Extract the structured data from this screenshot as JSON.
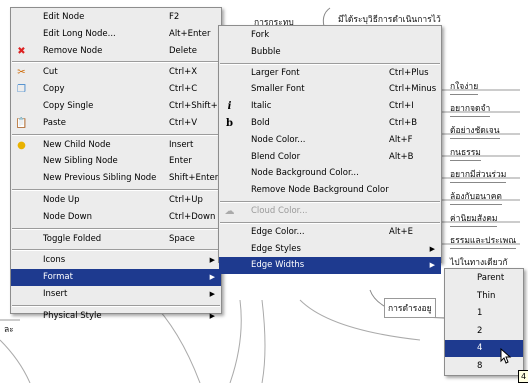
{
  "mindmap": {
    "nodes": [
      "มีได้ระบุวิธีการดำเนินการไว้",
      "การกระทบ",
      "กใจง่าย",
      "อยากจดจำ",
      "ด้อย่างชัดเจน",
      "กนธรรม",
      "อยากมีส่วนร่วม",
      "ล้องกับอนาคต",
      "ค่านิยมสังคม",
      "ธรรมและประเพณ",
      "ไปในทางเดียวกั",
      "การดำรงอยู",
      "ละ"
    ]
  },
  "main_menu": {
    "items": [
      {
        "label": "Edit Node",
        "accel": "F2",
        "icon": ""
      },
      {
        "label": "Edit Long Node...",
        "accel": "Alt+Enter",
        "icon": ""
      },
      {
        "label": "Remove Node",
        "accel": "Delete",
        "icon": "remove-icon"
      },
      {
        "sep": true
      },
      {
        "label": "Cut",
        "accel": "Ctrl+X",
        "icon": "cut-icon"
      },
      {
        "label": "Copy",
        "accel": "Ctrl+C",
        "icon": "copy-icon"
      },
      {
        "label": "Copy Single",
        "accel": "Ctrl+Shift+C",
        "icon": ""
      },
      {
        "label": "Paste",
        "accel": "Ctrl+V",
        "icon": "paste-icon"
      },
      {
        "sep": true
      },
      {
        "label": "New Child Node",
        "accel": "Insert",
        "icon": "bulb-icon"
      },
      {
        "label": "New Sibling Node",
        "accel": "Enter",
        "icon": ""
      },
      {
        "label": "New Previous Sibling Node",
        "accel": "Shift+Enter",
        "icon": ""
      },
      {
        "sep": true
      },
      {
        "label": "Node Up",
        "accel": "Ctrl+Up",
        "icon": ""
      },
      {
        "label": "Node Down",
        "accel": "Ctrl+Down",
        "icon": ""
      },
      {
        "sep": true
      },
      {
        "label": "Toggle Folded",
        "accel": "Space",
        "icon": ""
      },
      {
        "sep": true
      },
      {
        "label": "Icons",
        "accel": "",
        "submenu": true
      },
      {
        "label": "Format",
        "accel": "",
        "submenu": true,
        "selected": true
      },
      {
        "label": "Insert",
        "accel": "",
        "submenu": true
      },
      {
        "sep": true
      },
      {
        "label": "Physical Style",
        "accel": "",
        "submenu": true
      }
    ]
  },
  "format_menu": {
    "items": [
      {
        "label": "Fork",
        "accel": ""
      },
      {
        "label": "Bubble",
        "accel": ""
      },
      {
        "sep": true
      },
      {
        "label": "Larger Font",
        "accel": "Ctrl+Plus"
      },
      {
        "label": "Smaller Font",
        "accel": "Ctrl+Minus"
      },
      {
        "label": "Italic",
        "accel": "Ctrl+I",
        "icon": "italic-icon"
      },
      {
        "label": "Bold",
        "accel": "Ctrl+B",
        "icon": "bold-icon"
      },
      {
        "label": "Node Color...",
        "accel": "Alt+F"
      },
      {
        "label": "Blend Color",
        "accel": "Alt+B"
      },
      {
        "label": "Node Background Color...",
        "accel": ""
      },
      {
        "label": "Remove Node Background Color",
        "accel": ""
      },
      {
        "sep": true
      },
      {
        "label": "Cloud Color...",
        "accel": "",
        "disabled": true,
        "icon": "cloud-icon"
      },
      {
        "sep": true
      },
      {
        "label": "Edge Color...",
        "accel": "Alt+E"
      },
      {
        "label": "Edge Styles",
        "accel": "",
        "submenu": true
      },
      {
        "label": "Edge Widths",
        "accel": "",
        "submenu": true,
        "selected": true
      }
    ]
  },
  "edge_widths_menu": {
    "items": [
      {
        "label": "Parent"
      },
      {
        "label": "Thin"
      },
      {
        "label": "1"
      },
      {
        "label": "2"
      },
      {
        "label": "4",
        "selected": true
      },
      {
        "label": "8"
      }
    ]
  },
  "tooltip": {
    "text": "4"
  },
  "colors": {
    "selection": "#1e3a8f",
    "menu_bg": "#ececec"
  }
}
